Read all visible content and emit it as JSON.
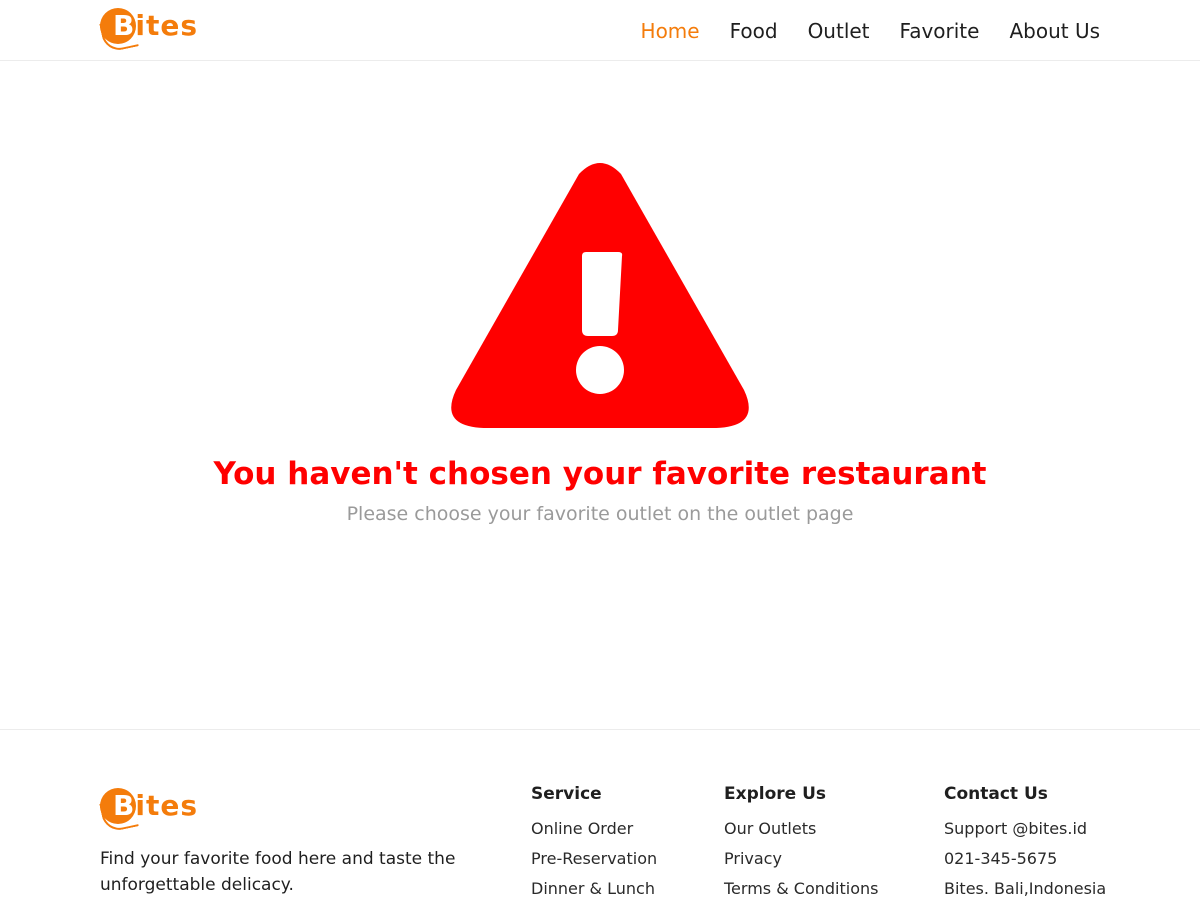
{
  "brand": {
    "name_first": "B",
    "name_rest": "ites",
    "color": "#f47c0b"
  },
  "nav": {
    "items": [
      {
        "label": "Home",
        "active": true
      },
      {
        "label": "Food"
      },
      {
        "label": "Outlet"
      },
      {
        "label": "Favorite"
      },
      {
        "label": "About Us"
      }
    ]
  },
  "main": {
    "icon": "warning-triangle-icon",
    "icon_color": "#ff0000",
    "headline": "You haven't chosen your favorite restaurant",
    "subline": "Please choose your favorite outlet on the outlet page"
  },
  "footer": {
    "tagline_line1": "Find your favorite food here and taste the",
    "tagline_line2": "unforgettable delicacy.",
    "service": {
      "title": "Service",
      "links": [
        "Online Order",
        "Pre-Reservation",
        "Dinner & Lunch"
      ]
    },
    "explore": {
      "title": "Explore Us",
      "links": [
        "Our Outlets",
        "Privacy",
        "Terms & Conditions"
      ]
    },
    "contact": {
      "title": "Contact Us",
      "links": [
        "Support @bites.id",
        "021-345-5675",
        "Bites. Bali,Indonesia"
      ]
    }
  }
}
